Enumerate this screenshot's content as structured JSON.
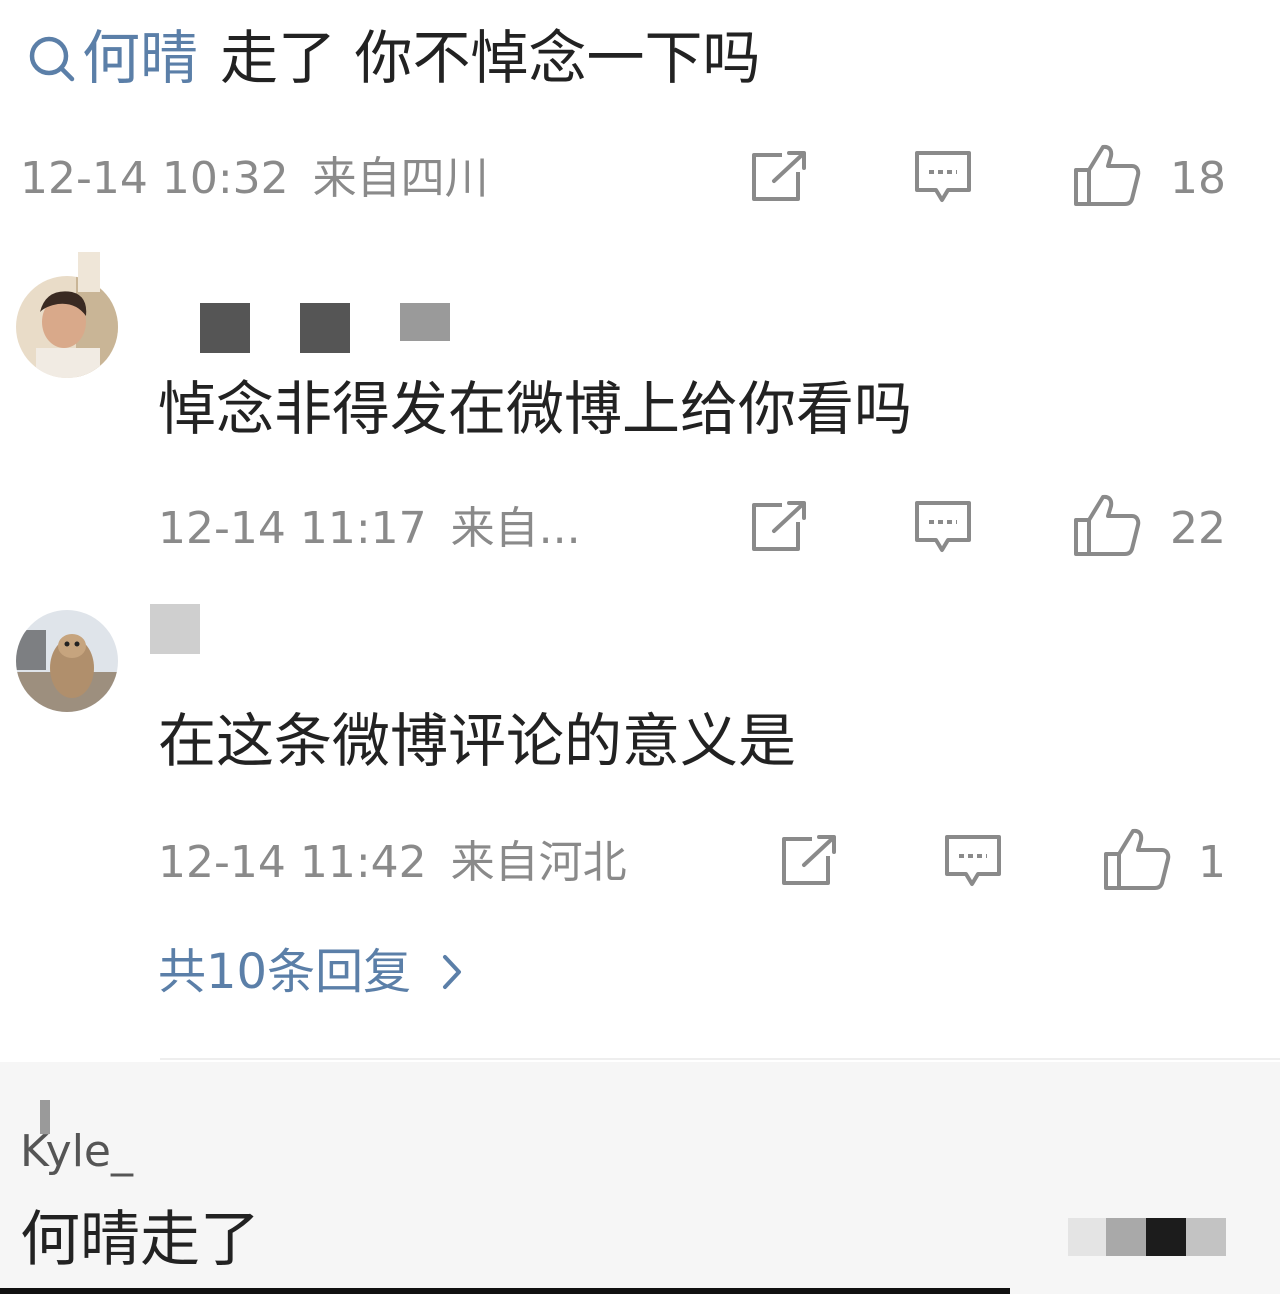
{
  "post": {
    "search_term": "何晴",
    "text": "走了 你不悼念一下吗",
    "date": "12-14 10:32",
    "location": "来自四川",
    "likes": "18"
  },
  "comments": [
    {
      "text": "悼念非得发在微博上给你看吗",
      "date": "12-14 11:17",
      "location": "来自...",
      "likes": "22"
    },
    {
      "text": "在这条微博评论的意义是",
      "date": "12-14 11:42",
      "location": "来自河北",
      "likes": "1"
    }
  ],
  "more_replies": "共10条回复",
  "bottom_comment": {
    "username": "Kyle_",
    "text": "何晴走了"
  },
  "icons": {
    "search": "search-icon",
    "repost": "share-edit-icon",
    "comment": "comment-bubble-icon",
    "like": "thumbs-up-icon",
    "chevron": "chevron-right-icon"
  },
  "colors": {
    "link": "#5b7fa8",
    "meta": "#8a8a8a",
    "text": "#222222"
  }
}
